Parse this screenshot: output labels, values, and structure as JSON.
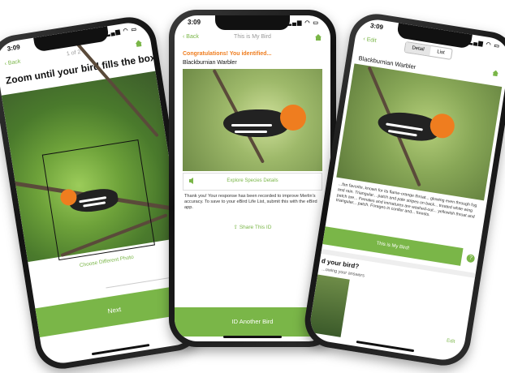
{
  "accent_color": "#7ab648",
  "highlight_color": "#ef7d1f",
  "phone_left": {
    "time": "3:09",
    "back_label": "Back",
    "counter": "1 of 2",
    "heading": "Zoom until your bird fills the box",
    "choose_link": "Choose Different Photo",
    "next_label": "Next"
  },
  "phone_center": {
    "time": "3:09",
    "back_label": "Back",
    "nav_title": "This is My Bird",
    "congrats": "Congratulations! You identified...",
    "bird_name": "Blackburnian Warbler",
    "explore_label": "Explore Species Details",
    "thanks_text": "Thank you! Your response has been recorded to improve Merlin's accuracy. To save to your eBird Life List, submit this with the eBird app.",
    "share_label": "Share This ID",
    "id_another_label": "ID Another Bird"
  },
  "phone_right": {
    "time": "3:09",
    "edit_label": "Edit",
    "tab_detail": "Detail",
    "tab_list": "List",
    "bird_name": "Blackburnian Warbler",
    "description": "...fan favorite, known for its flame-orange throat... glowing even through fog and rain. Triangular... patch and pale stripes on back... treated white wing patch are... Females and immatures are washed-out... yellowish throat and triangular... patch. Forages in conifer and... forests.",
    "my_bird_label": "This is My Bird!",
    "question": "d your bird?",
    "question_sub": "...owing your answers",
    "edit_bottom": "Edit"
  }
}
